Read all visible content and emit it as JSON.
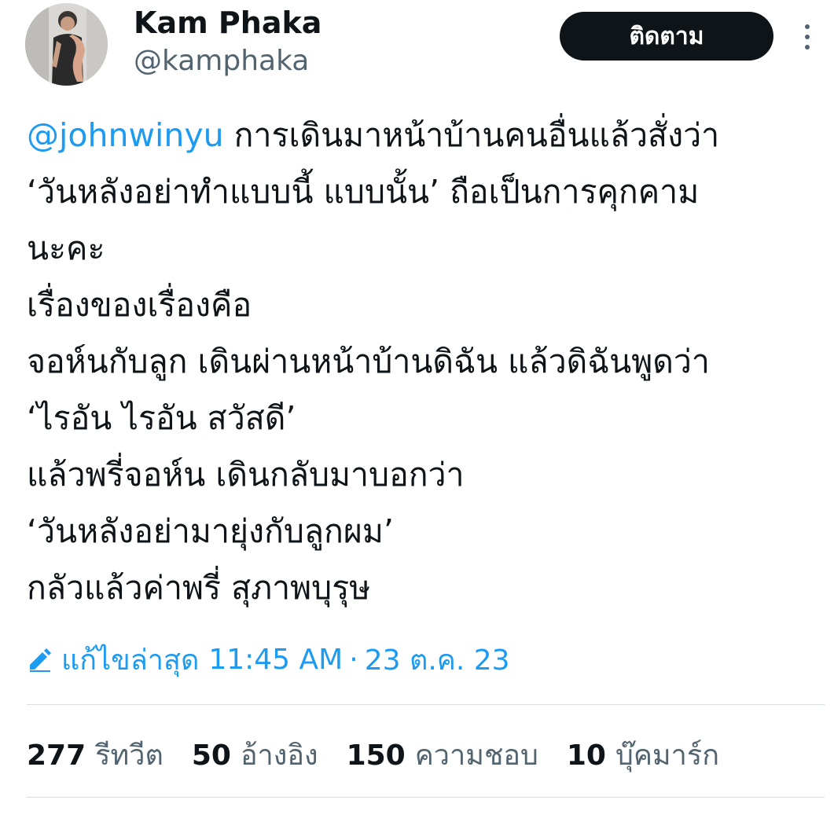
{
  "header": {
    "display_name": "Kam Phaka",
    "handle": "@kamphaka",
    "follow_label": "ติดตาม"
  },
  "tweet": {
    "mention": "@johnwinyu",
    "lines": [
      " การเดินมาหน้าบ้านคนอื่นแล้วสั่งว่า",
      "‘วันหลังอย่าทำแบบนี้ แบบนั้น’ ถือเป็นการคุกคาม",
      "นะคะ",
      "เรื่องของเรื่องคือ",
      "จอห์นกับลูก เดินผ่านหน้าบ้านดิฉัน แล้วดิฉันพูดว่า",
      "‘ไรอัน ไรอัน สวัสดี’",
      "แล้วพรี่จอห์น เดินกลับมาบอกว่า",
      "‘วันหลังอย่ามายุ่งกับลูกผม’",
      "กลัวแล้วค่าพรี่ สุภาพบุรุษ"
    ]
  },
  "meta": {
    "edited_label": "แก้ไขล่าสุด",
    "time": "11:45 AM",
    "separator": "·",
    "date": "23 ต.ค. 23"
  },
  "stats": [
    {
      "count": "277",
      "label": "รีทวีต"
    },
    {
      "count": "50",
      "label": "อ้างอิง"
    },
    {
      "count": "150",
      "label": "ความชอบ"
    },
    {
      "count": "10",
      "label": "บุ๊คมาร์ก"
    }
  ],
  "colors": {
    "accent": "#1d9bf0",
    "text": "#0f1419",
    "secondary": "#536471",
    "button_bg": "#0f1419"
  }
}
